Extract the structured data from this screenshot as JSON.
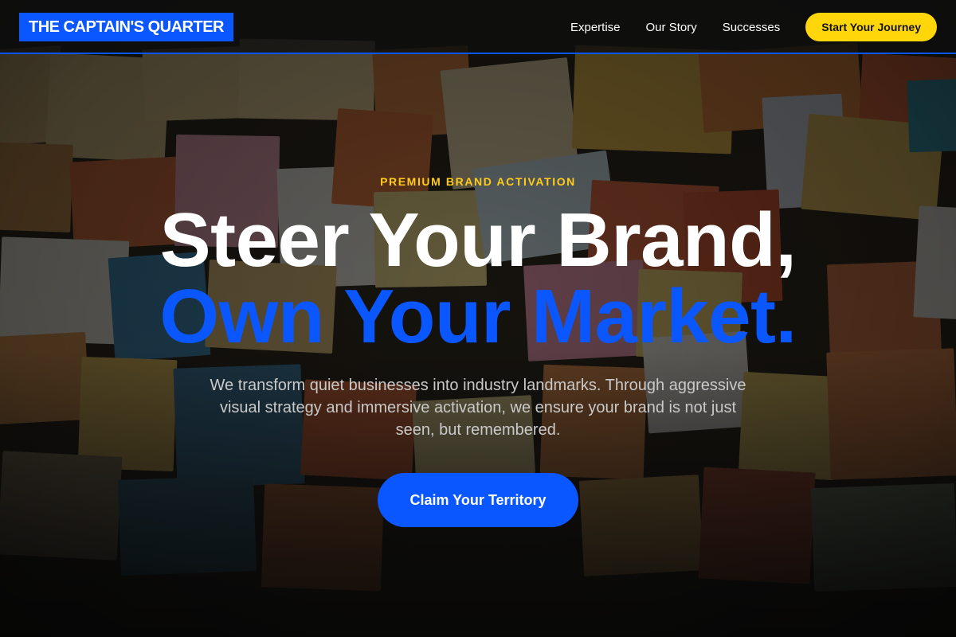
{
  "header": {
    "logo_text": "THE CAPTAIN'S QUARTER",
    "nav": [
      {
        "label": "Expertise"
      },
      {
        "label": "Our Story"
      },
      {
        "label": "Successes"
      }
    ],
    "cta_label": "Start Your Journey"
  },
  "hero": {
    "eyebrow": "PREMIUM BRAND ACTIVATION",
    "headline_line1": "Steer Your Brand,",
    "headline_line2": "Own Your Market.",
    "subtext": "We transform quiet businesses into industry landmarks. Through aggressive visual strategy and immersive activation, we ensure your brand is not just seen, but remembered.",
    "cta_label": "Claim Your Territory"
  },
  "colors": {
    "brand_blue": "#0a57ff",
    "accent_yellow": "#ffd60a",
    "eyebrow_yellow": "#ffcc1a",
    "header_bg": "#0e0e0e"
  }
}
